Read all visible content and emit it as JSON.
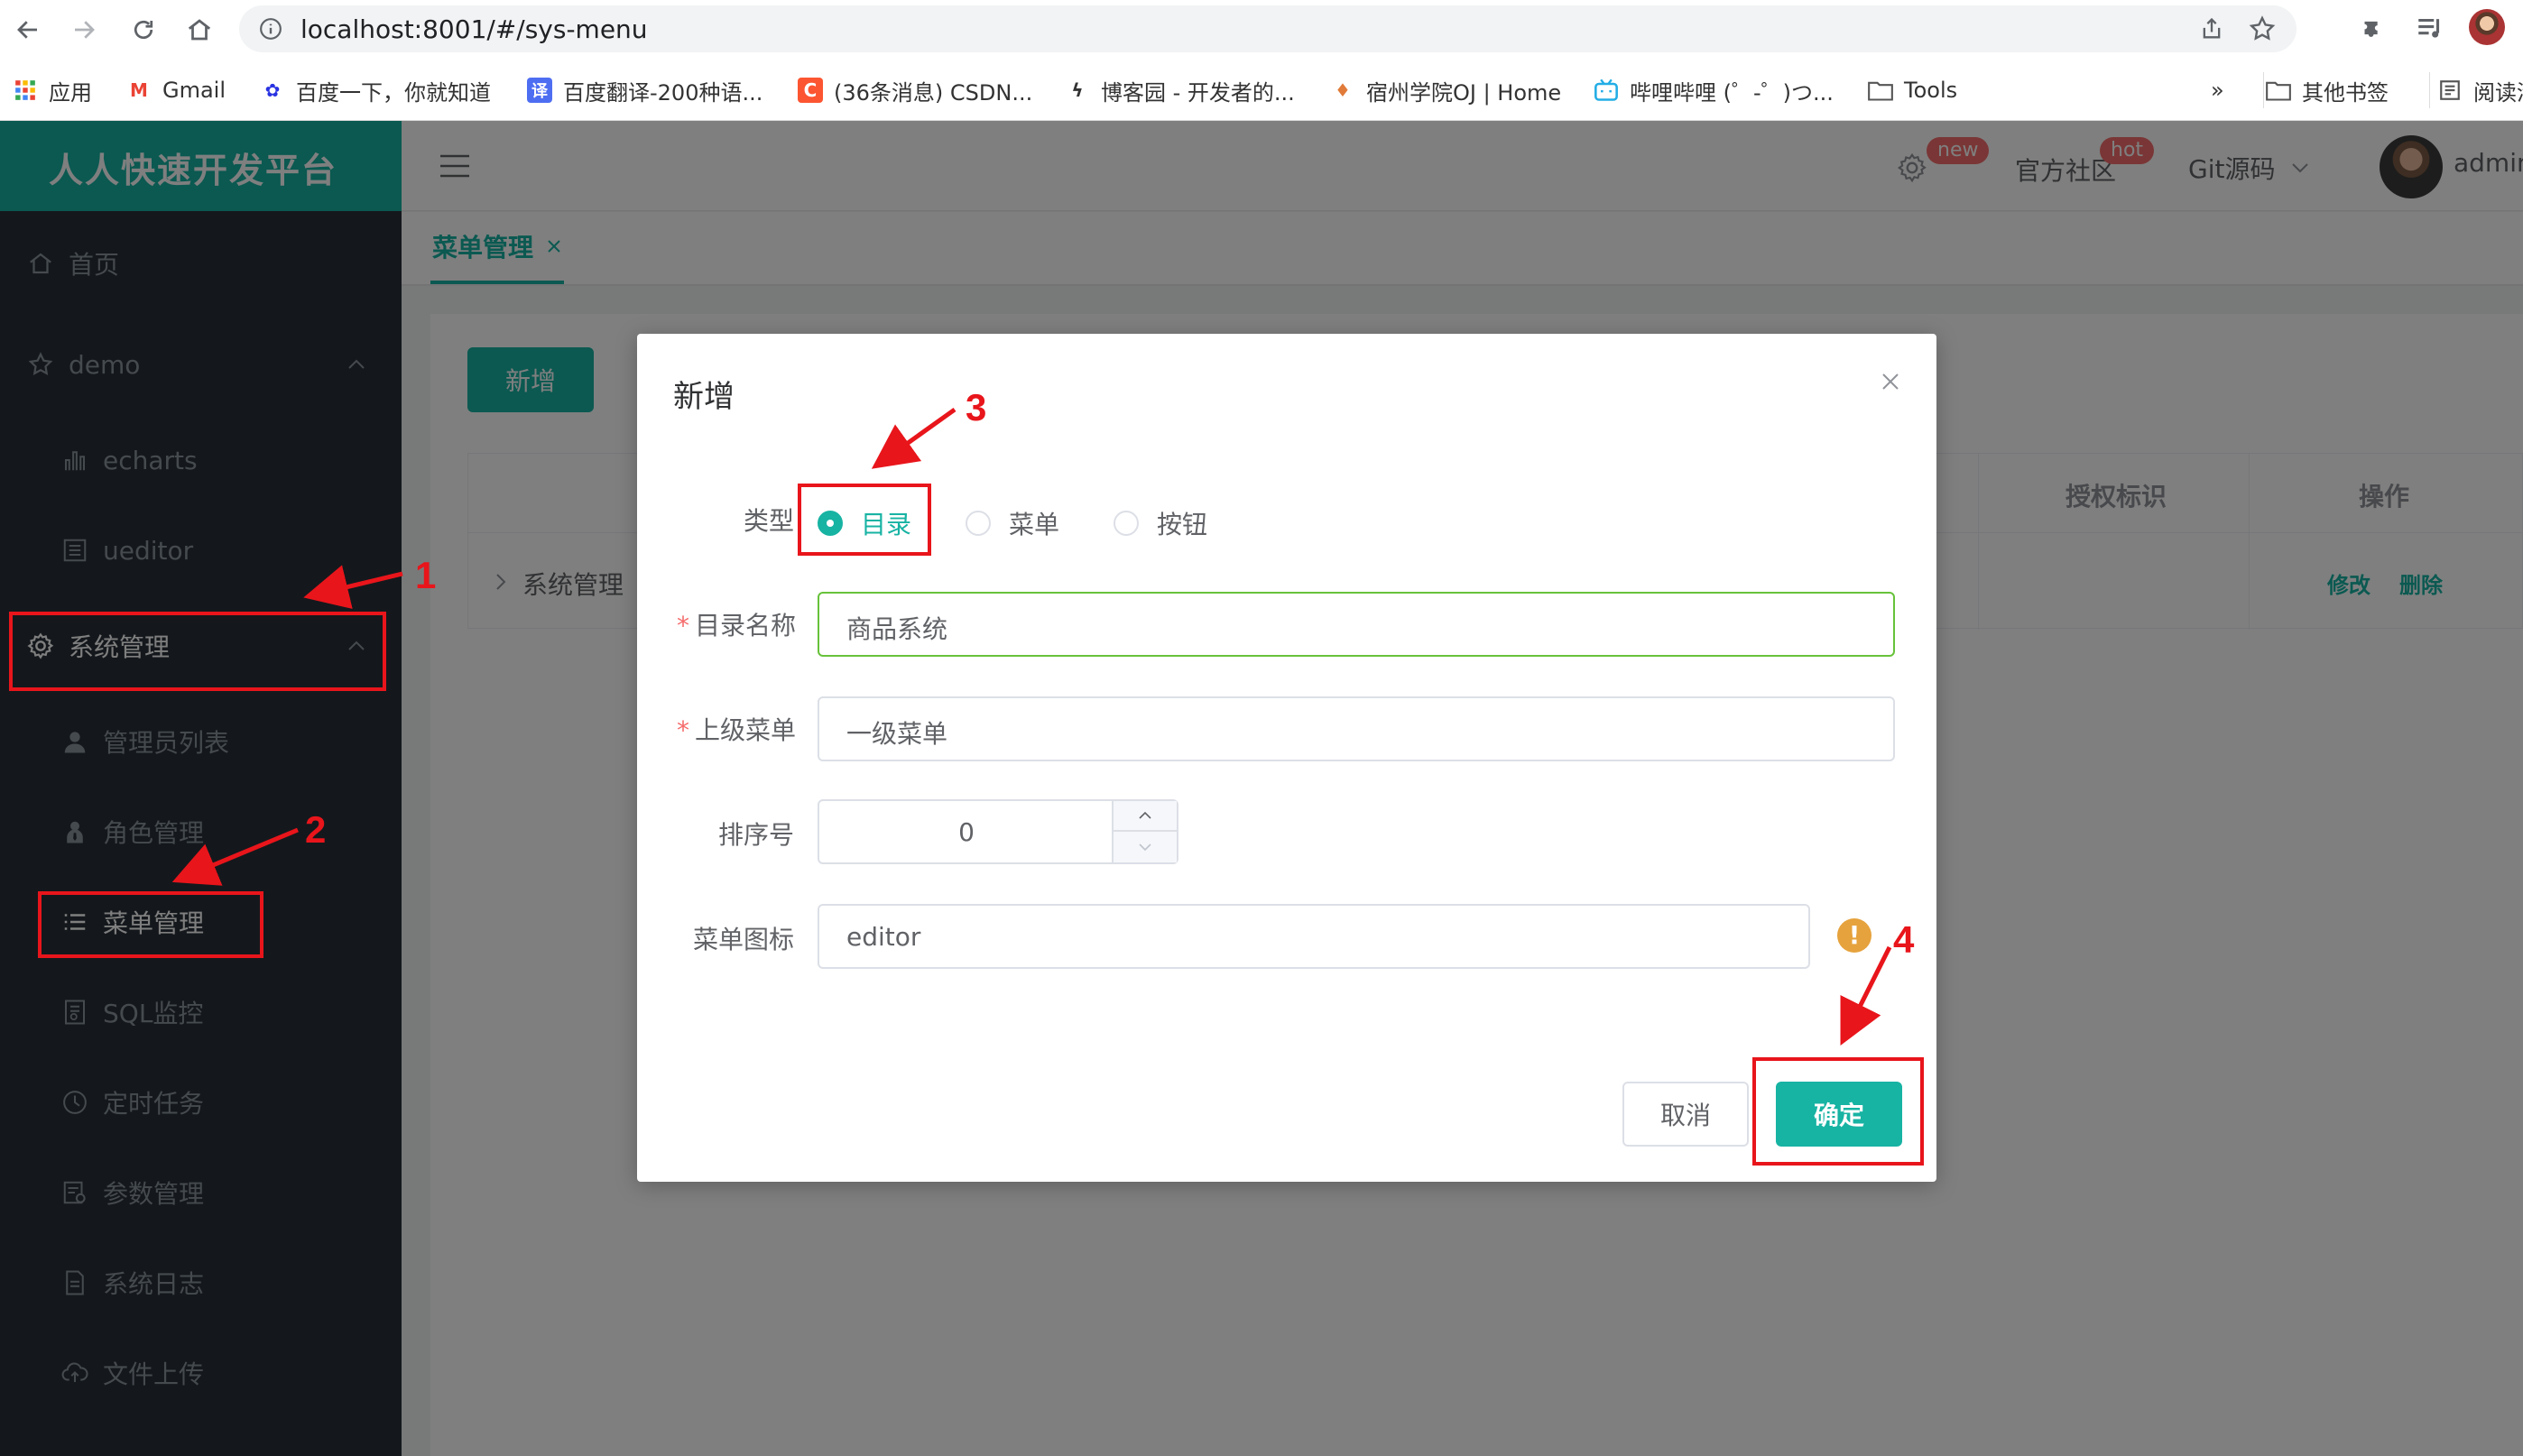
{
  "browser": {
    "url": "localhost:8001/#/sys-menu",
    "bookmarks": [
      {
        "label": "应用",
        "icon": "apps-grid-icon",
        "color": "#ea4335"
      },
      {
        "label": "Gmail",
        "icon": "gmail-icon",
        "color": "#ea4335"
      },
      {
        "label": "百度一下，你就知道",
        "icon": "baidu-paw-icon",
        "color": "#2932e1"
      },
      {
        "label": "百度翻译-200种语...",
        "icon": "baidu-translate-icon",
        "color": "#4e6ef2"
      },
      {
        "label": "(36条消息) CSDN...",
        "icon": "csdn-icon",
        "color": "#fc5531"
      },
      {
        "label": "博客园 - 开发者的...",
        "icon": "cnblogs-icon",
        "color": "#333333"
      },
      {
        "label": "宿州学院OJ | Home",
        "icon": "balloon-icon",
        "color": "#e07b39"
      },
      {
        "label": "哔哩哔哩 (゜-゜)つ...",
        "icon": "bilibili-icon",
        "color": "#23ade5"
      },
      {
        "label": "Tools",
        "icon": "folder-icon",
        "color": "#555555"
      }
    ],
    "more": "»",
    "other_bookmarks": "其他书签",
    "reading_list": "阅读清"
  },
  "header": {
    "badge_new": "new",
    "community": "官方社区",
    "badge_hot": "hot",
    "git_source": "Git源码",
    "user": "admin"
  },
  "sidebar": {
    "brand": "人人快速开发平台",
    "items": [
      {
        "label": "首页",
        "icon": "home-icon"
      },
      {
        "label": "demo",
        "icon": "star-icon"
      },
      {
        "label": "echarts",
        "icon": "bar-chart-icon"
      },
      {
        "label": "ueditor",
        "icon": "editor-icon"
      },
      {
        "label": "系统管理",
        "icon": "gear-icon"
      },
      {
        "label": "管理员列表",
        "icon": "user-icon"
      },
      {
        "label": "角色管理",
        "icon": "role-icon"
      },
      {
        "label": "菜单管理",
        "icon": "list-icon"
      },
      {
        "label": "SQL监控",
        "icon": "sql-icon"
      },
      {
        "label": "定时任务",
        "icon": "clock-icon"
      },
      {
        "label": "参数管理",
        "icon": "params-icon"
      },
      {
        "label": "系统日志",
        "icon": "log-icon"
      },
      {
        "label": "文件上传",
        "icon": "upload-icon"
      }
    ]
  },
  "tabs": {
    "active": "菜单管理"
  },
  "main": {
    "add_button": "新增",
    "columns": {
      "auth": "授权标识",
      "ops": "操作"
    },
    "row": {
      "name": "系统管理",
      "edit": "修改",
      "delete": "删除"
    }
  },
  "dialog": {
    "title": "新增",
    "type_label": "类型",
    "type_options": [
      "目录",
      "菜单",
      "按钮"
    ],
    "type_selected": "目录",
    "name_label": "目录名称",
    "name_value": "商品系统",
    "parent_label": "上级菜单",
    "parent_value": "一级菜单",
    "order_label": "排序号",
    "order_value": "0",
    "icon_label": "菜单图标",
    "icon_value": "editor",
    "cancel": "取消",
    "ok": "确定"
  },
  "annotations": [
    "1",
    "2",
    "3",
    "4"
  ],
  "colors": {
    "accent": "#17b3a3",
    "sidebar_bg": "#293038",
    "annotation": "#e8151b",
    "badge": "#f56c6c",
    "warning": "#e6a23c",
    "focus_border": "#67c23a"
  }
}
